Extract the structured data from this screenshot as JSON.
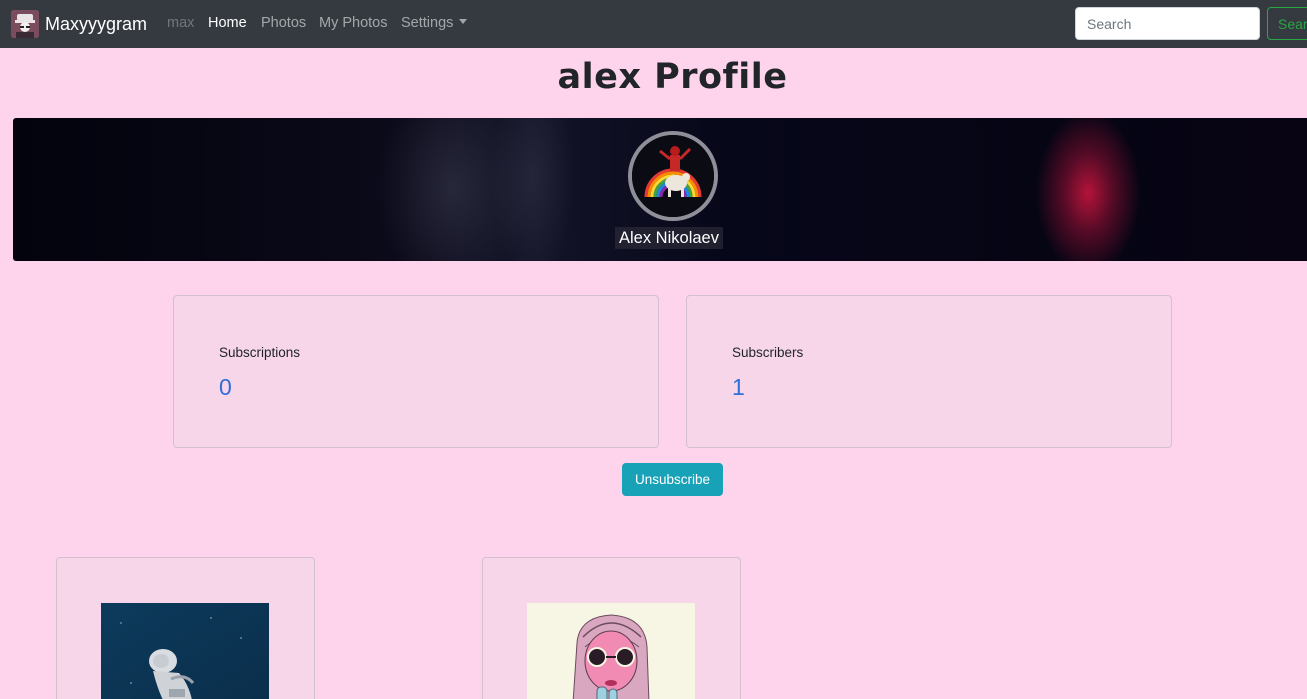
{
  "navbar": {
    "brand": "Maxyyygram",
    "brand_icon": "app-logo-icon",
    "username": "max",
    "links": [
      "Home",
      "Photos",
      "My Photos",
      "Settings"
    ],
    "active_link": "Home",
    "search_placeholder": "Search",
    "search_button": "Sear"
  },
  "profile": {
    "title": "alex Profile",
    "full_name": "Alex Nikolaev"
  },
  "stats": [
    {
      "label": "Subscriptions",
      "value": "0"
    },
    {
      "label": "Subscribers",
      "value": "1"
    }
  ],
  "actions": {
    "unsubscribe": "Unsubscribe"
  },
  "photos": [
    {
      "subject": "astronaut-illustration"
    },
    {
      "subject": "girl-with-sunglasses-illustration"
    }
  ],
  "colors": {
    "page_background": "#fed3ec",
    "navbar": "#343a40",
    "stat_value": "#2f6fd8",
    "unsubscribe_button": "#17a2b8",
    "search_button": "#28a745"
  }
}
